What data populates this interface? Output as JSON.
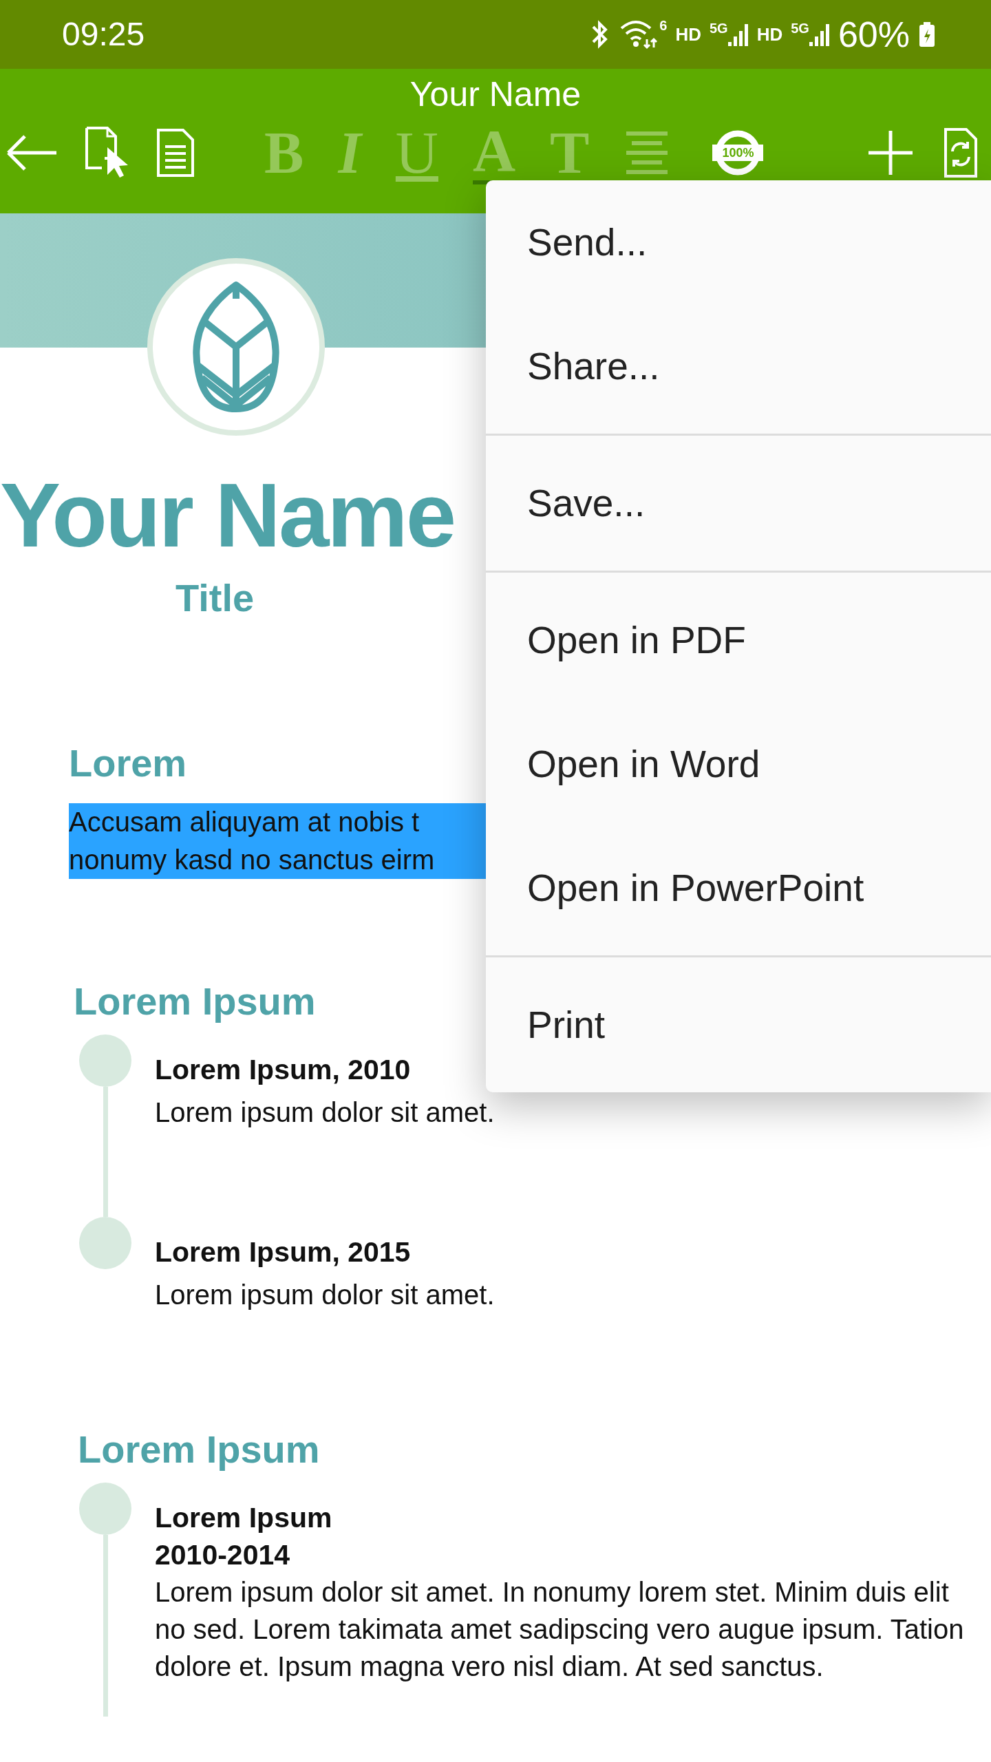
{
  "status_bar": {
    "time": "09:25",
    "wifi_badge": "6",
    "networks": [
      {
        "label": "HD",
        "band": "5G"
      },
      {
        "label": "HD",
        "band": "5G"
      }
    ],
    "battery": "60%"
  },
  "toolbar": {
    "title": "Your Name",
    "format_buttons": [
      {
        "label": "B",
        "kind": "bold",
        "disabled": true
      },
      {
        "label": "I",
        "kind": "italic",
        "disabled": true
      },
      {
        "label": "U",
        "kind": "underline",
        "disabled": true
      },
      {
        "label": "A",
        "kind": "color",
        "disabled": true
      },
      {
        "label": "T",
        "kind": "size",
        "disabled": true
      }
    ],
    "zoom": "100%"
  },
  "document": {
    "name": "Your Name",
    "title": "Title",
    "sections": [
      {
        "heading": "Lorem",
        "kind": "text",
        "selected": true,
        "lines": [
          "Accusam aliquyam at nobis t",
          "nonumy kasd no sanctus eirm"
        ]
      },
      {
        "heading": "Lorem Ipsum",
        "kind": "timeline",
        "entries": [
          {
            "title": "Lorem Ipsum, 2010",
            "text": "Lorem ipsum dolor sit amet."
          },
          {
            "title": "Lorem Ipsum, 2015",
            "text": "Lorem ipsum dolor sit amet."
          }
        ]
      },
      {
        "heading": "Lorem Ipsum",
        "kind": "timeline",
        "entries": [
          {
            "title": "Lorem Ipsum",
            "subtitle": "2010-2014",
            "text": "Lorem ipsum dolor sit amet. In nonumy lorem stet. Minim duis elit no sed.  Lorem takimata amet sadipscing vero augue ipsum. Tation dolore et. Ipsum magna vero nisl diam. At sed sanctus."
          }
        ]
      }
    ]
  },
  "menu": {
    "groups": [
      [
        "Send...",
        "Share..."
      ],
      [
        "Save..."
      ],
      [
        "Open in PDF",
        "Open in Word",
        "Open in PowerPoint"
      ],
      [
        "Print"
      ]
    ]
  }
}
